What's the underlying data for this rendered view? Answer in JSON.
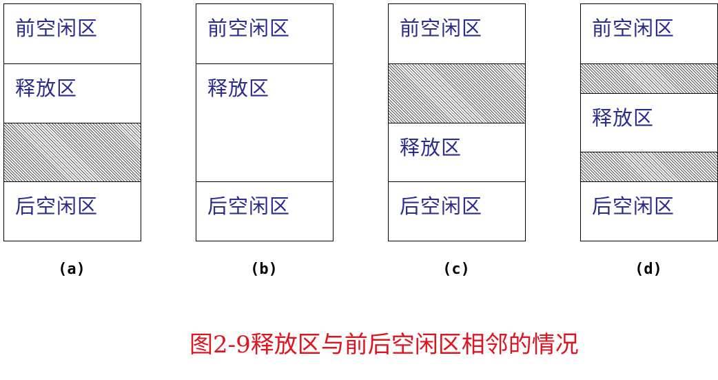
{
  "labels": {
    "front_free": "前空闲区",
    "release": "释放区",
    "back_free": "后空闲区"
  },
  "panels": [
    {
      "caption": "(a)",
      "blocks": [
        {
          "kind": "front-free",
          "label": "前空闲区",
          "hatched": false
        },
        {
          "kind": "release",
          "label": "释放区",
          "hatched": false
        },
        {
          "kind": "occupied",
          "label": "",
          "hatched": true
        },
        {
          "kind": "back-free",
          "label": "后空闲区",
          "hatched": false
        }
      ]
    },
    {
      "caption": "(b)",
      "blocks": [
        {
          "kind": "front-free",
          "label": "前空闲区",
          "hatched": false
        },
        {
          "kind": "release",
          "label": "释放区",
          "hatched": false
        },
        {
          "kind": "back-free",
          "label": "后空闲区",
          "hatched": false
        }
      ]
    },
    {
      "caption": "(c)",
      "blocks": [
        {
          "kind": "front-free",
          "label": "前空闲区",
          "hatched": false
        },
        {
          "kind": "occupied",
          "label": "",
          "hatched": true
        },
        {
          "kind": "release",
          "label": "释放区",
          "hatched": false
        },
        {
          "kind": "back-free",
          "label": "后空闲区",
          "hatched": false
        }
      ]
    },
    {
      "caption": "(d)",
      "blocks": [
        {
          "kind": "front-free",
          "label": "前空闲区",
          "hatched": false
        },
        {
          "kind": "occupied",
          "label": "",
          "hatched": true
        },
        {
          "kind": "release",
          "label": "释放区",
          "hatched": false
        },
        {
          "kind": "occupied",
          "label": "",
          "hatched": true
        },
        {
          "kind": "back-free",
          "label": "后空闲区",
          "hatched": false
        }
      ]
    }
  ],
  "figure_title": "图2-9释放区与前后空闲区相邻的情况",
  "colors": {
    "label_text": "#2b2b8f",
    "title_text": "#e0141e",
    "border": "#000000",
    "hatch": "#555555"
  }
}
